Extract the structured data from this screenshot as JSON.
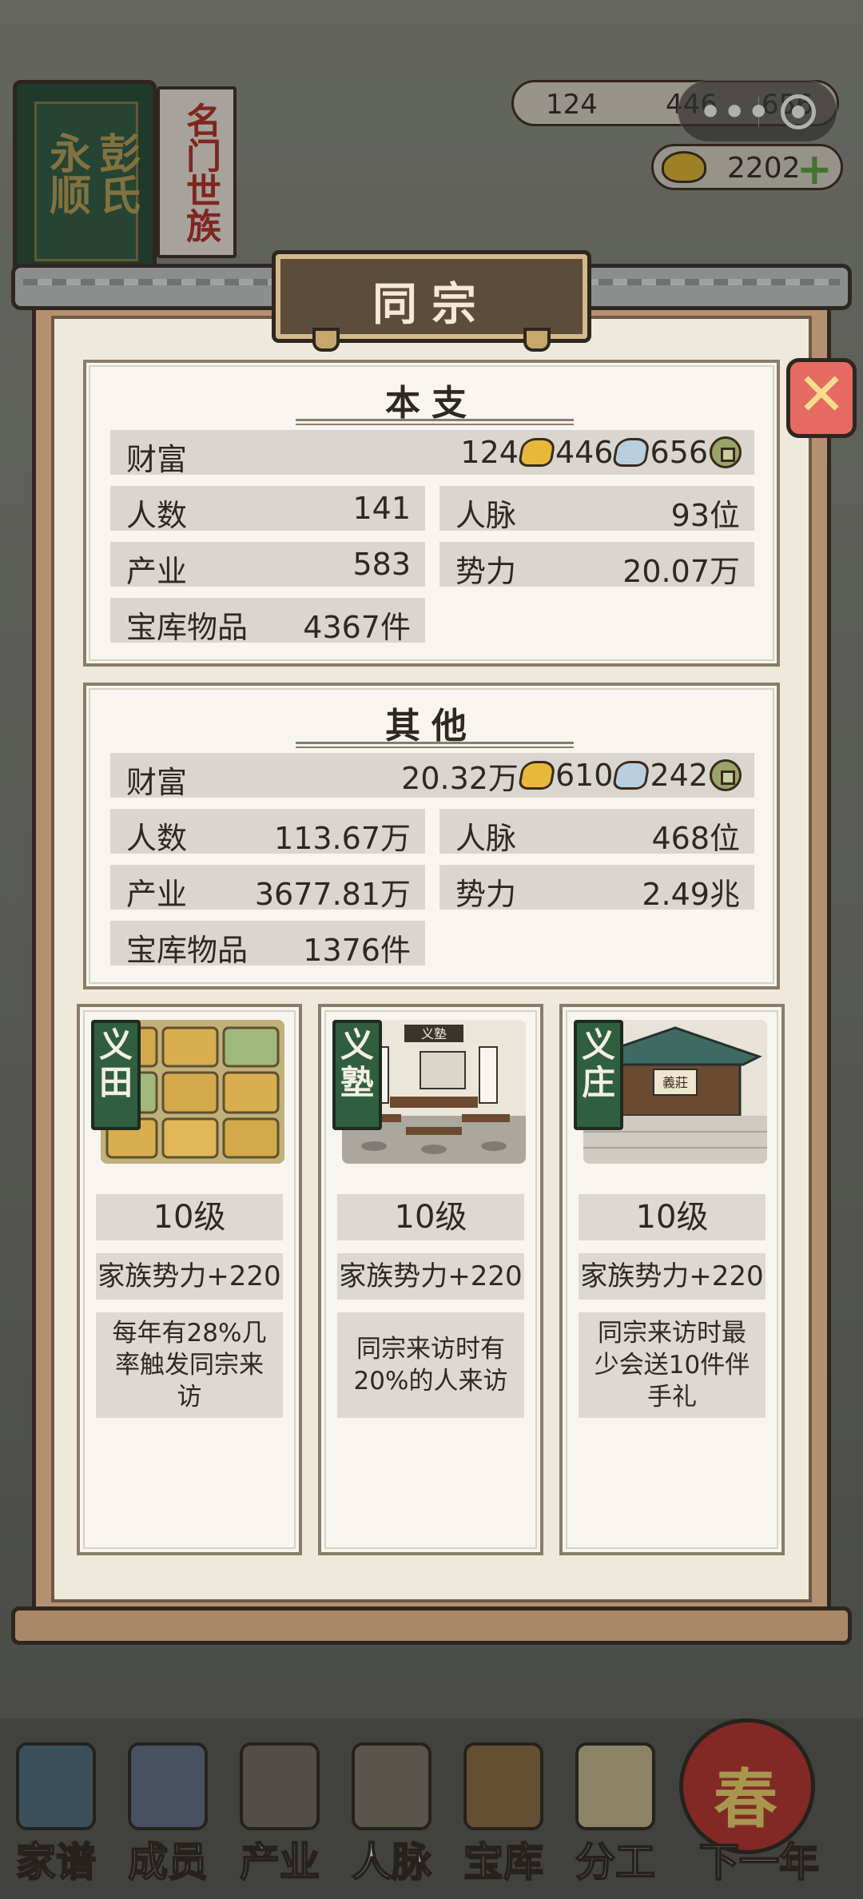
{
  "background": {
    "book_left": "永顺",
    "book_right": "彭氏",
    "tag": "名门世族",
    "resources": {
      "gold_bar": "124",
      "silver": "446",
      "coin": "656"
    },
    "ingot": "2202",
    "bottom_nav": [
      "家谱",
      "成员",
      "产业",
      "人脉",
      "宝库",
      "分工",
      "下一年"
    ],
    "lantern": "春"
  },
  "modal": {
    "title": "同宗",
    "close_label": "✕",
    "main": {
      "title": "本支",
      "wealth": {
        "label": "财富",
        "gold": "124",
        "silver": "446",
        "coin": "656"
      },
      "population": {
        "label": "人数",
        "value": "141"
      },
      "connections": {
        "label": "人脉",
        "value": "93位"
      },
      "industry": {
        "label": "产业",
        "value": "583"
      },
      "influence": {
        "label": "势力",
        "value": "20.07万"
      },
      "treasury": {
        "label": "宝库物品",
        "value": "4367件"
      }
    },
    "other": {
      "title": "其他",
      "wealth": {
        "label": "财富",
        "gold": "20.32万",
        "silver": "610",
        "coin": "242"
      },
      "population": {
        "label": "人数",
        "value": "113.67万"
      },
      "connections": {
        "label": "人脉",
        "value": "468位"
      },
      "industry": {
        "label": "产业",
        "value": "3677.81万"
      },
      "influence": {
        "label": "势力",
        "value": "2.49兆"
      },
      "treasury": {
        "label": "宝库物品",
        "value": "1376件"
      }
    },
    "facilities": [
      {
        "name": "义田",
        "level": "10级",
        "buff": "家族势力+220",
        "desc": "每年有28%几率触发同宗来访"
      },
      {
        "name": "义塾",
        "level": "10级",
        "buff": "家族势力+220",
        "desc": "同宗来访时有20%的人来访",
        "sign": "义塾"
      },
      {
        "name": "义庄",
        "level": "10级",
        "buff": "家族势力+220",
        "desc": "同宗来访时最少会送10件伴手礼",
        "sign": "義莊"
      }
    ]
  }
}
